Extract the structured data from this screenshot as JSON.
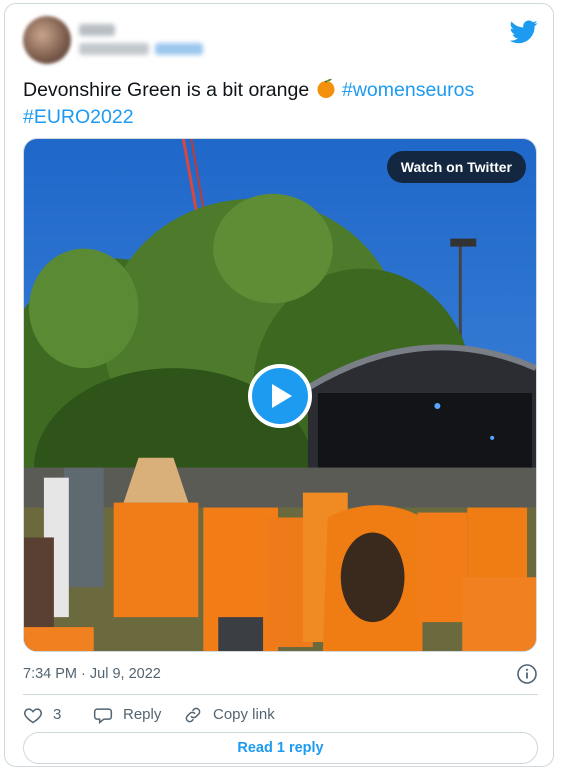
{
  "tweet": {
    "text_plain": "Devonshire Green is a bit orange ",
    "emoji_icon": "orange-fruit-icon",
    "hashtag_1": "#womenseuros",
    "hashtag_2": "#EURO2022"
  },
  "media": {
    "watch_label": "Watch on Twitter",
    "play_icon": "play-icon"
  },
  "meta": {
    "timestamp": "7:34 PM · Jul 9, 2022"
  },
  "actions": {
    "like_count": "3",
    "reply_label": "Reply",
    "copy_label": "Copy link"
  },
  "footer": {
    "read_reply_label": "Read 1 reply"
  },
  "colors": {
    "brand": "#1d9bf0",
    "text": "#0f1419",
    "muted": "#536471",
    "border": "#cfd9de"
  }
}
